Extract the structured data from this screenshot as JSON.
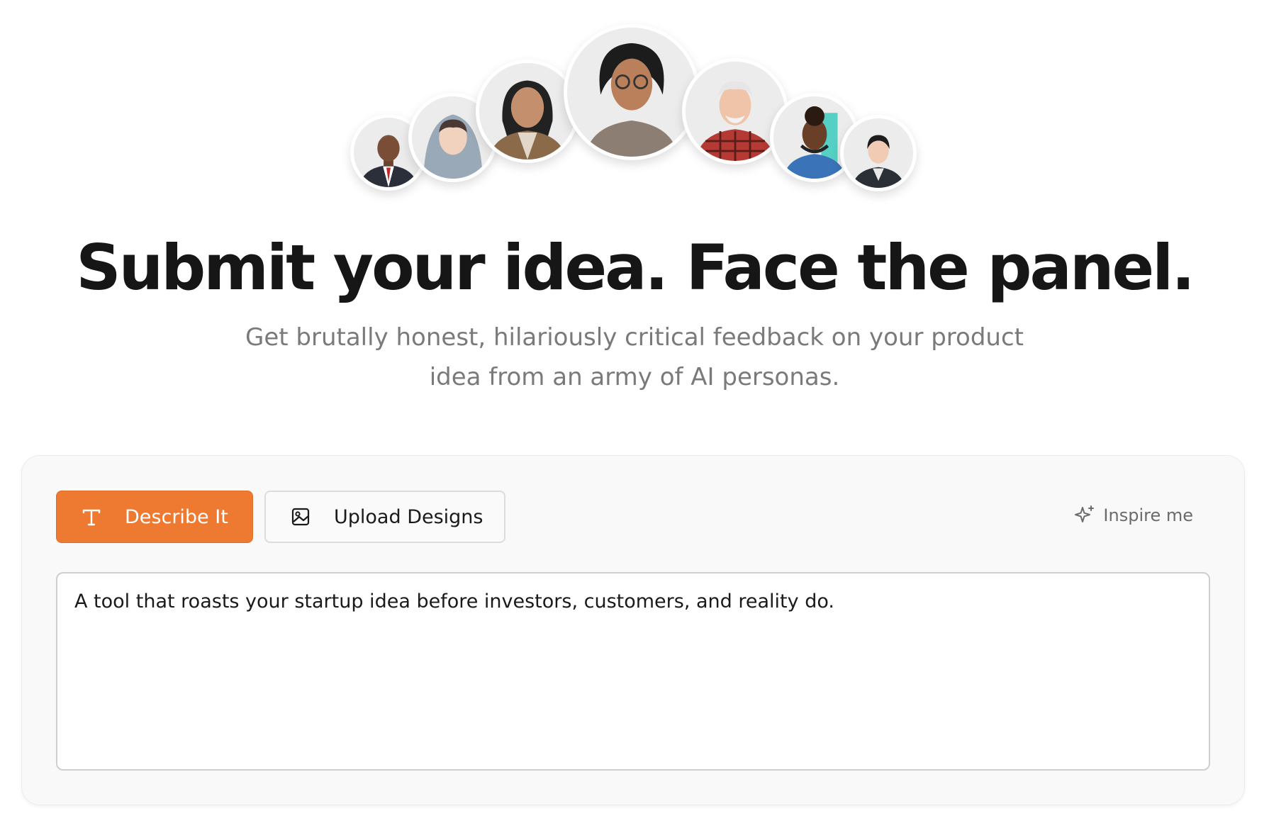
{
  "avatars": [
    {
      "persona": "businessman-in-suit",
      "icon": "avatar-icon"
    },
    {
      "persona": "hooded-young-woman",
      "icon": "avatar-icon"
    },
    {
      "persona": "woman-in-cardigan",
      "icon": "avatar-icon"
    },
    {
      "persona": "woman-with-glasses",
      "icon": "avatar-icon"
    },
    {
      "persona": "old-man-plaid-shirt",
      "icon": "avatar-icon"
    },
    {
      "persona": "woman-with-headphones",
      "icon": "avatar-icon"
    },
    {
      "persona": "businesswoman",
      "icon": "avatar-icon"
    }
  ],
  "hero": {
    "headline": "Submit your idea. Face the panel.",
    "subtitle_line1": "Get brutally honest, hilariously critical feedback on your product",
    "subtitle_line2": "idea from an army of AI personas."
  },
  "input_card": {
    "tabs": [
      {
        "label": "Describe It",
        "icon": "text-icon",
        "active": true
      },
      {
        "label": "Upload Designs",
        "icon": "image-icon",
        "active": false
      }
    ],
    "inspire_label": "Inspire me",
    "inspire_icon": "sparkles-icon",
    "idea_text": "A tool that roasts your startup idea before investors, customers, and reality do."
  },
  "colors": {
    "accent": "#ee7a32",
    "headline": "#161616",
    "subtitle": "#7a7a7a",
    "card_background": "#f9f9f9"
  }
}
